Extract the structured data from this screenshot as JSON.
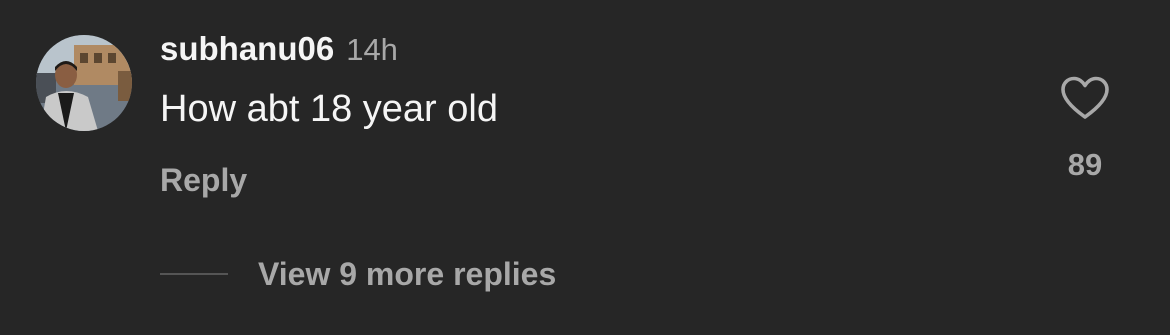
{
  "comment": {
    "avatar_icon": "user-avatar-photo",
    "username": "subhanu06",
    "timestamp": "14h",
    "text": "How abt 18 year old",
    "reply_label": "Reply",
    "like_icon": "heart-outline-icon",
    "like_count": "89",
    "view_replies_label": "View 9 more replies"
  },
  "colors": {
    "background": "#262626",
    "primary_text": "#f5f5f5",
    "secondary_text": "#a8a8a8"
  }
}
